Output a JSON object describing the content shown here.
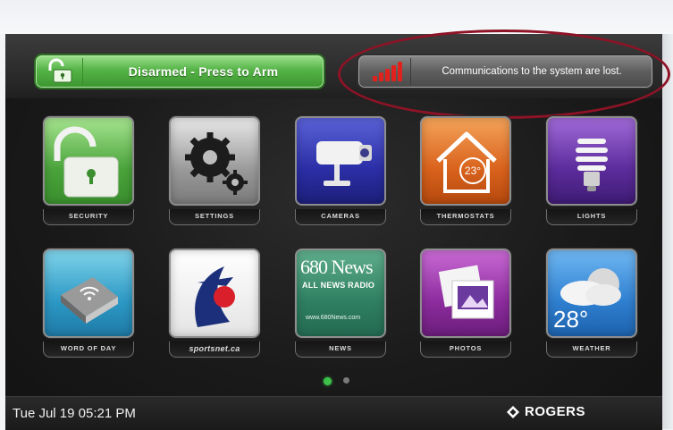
{
  "header": {
    "arm_button_label": "Disarmed - Press to Arm",
    "status_message": "Communications to the system are lost."
  },
  "tiles_row1": [
    {
      "label": "SECURITY",
      "icon": "unlocked-padlock-icon"
    },
    {
      "label": "SETTINGS",
      "icon": "gears-icon"
    },
    {
      "label": "CAMERAS",
      "icon": "security-camera-icon"
    },
    {
      "label": "THERMOSTATS",
      "icon": "house-thermostat-icon",
      "value": "23°"
    },
    {
      "label": "LIGHTS",
      "icon": "light-bulb-icon"
    }
  ],
  "tiles_row2": [
    {
      "label": "WORD OF DAY",
      "icon": "book-icon"
    },
    {
      "label": "sportsnet.ca",
      "icon": "sportsnet-logo-icon"
    },
    {
      "label": "NEWS",
      "icon": "news-icon",
      "title": "680 News",
      "subtitle": "ALL NEWS RADIO",
      "url": "www.680News.com"
    },
    {
      "label": "PHOTOS",
      "icon": "photos-icon"
    },
    {
      "label": "WEATHER",
      "icon": "weather-icon",
      "value": "28°"
    }
  ],
  "pagination": {
    "total": 2,
    "active": 1
  },
  "footer": {
    "datetime": "Tue Jul 19 05:21 PM",
    "brand": "ROGERS"
  },
  "colors": {
    "arm_green": "#55b347",
    "alert_red": "#e0221c",
    "annotation_ring": "#8e1326"
  }
}
